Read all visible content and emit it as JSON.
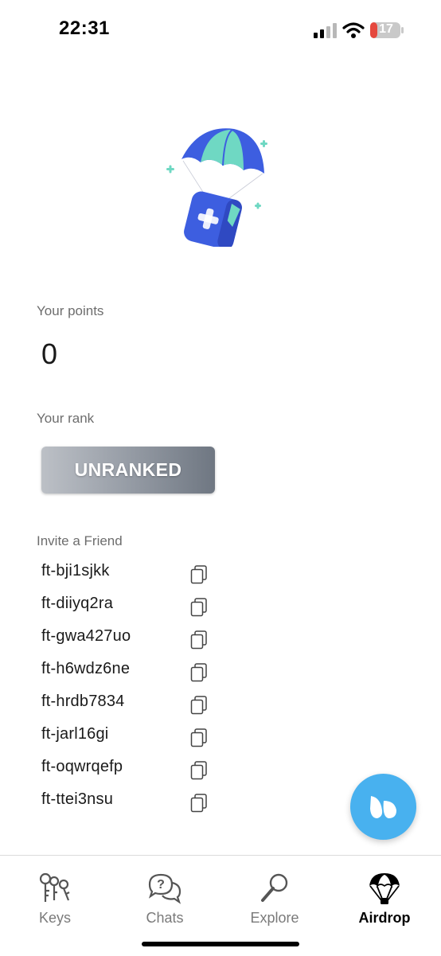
{
  "status_bar": {
    "time": "22:31",
    "battery": "17"
  },
  "points": {
    "label": "Your points",
    "value": "0"
  },
  "rank": {
    "label": "Your rank",
    "value": "UNRANKED"
  },
  "invite": {
    "label": "Invite a Friend",
    "codes": [
      "ft-bji1sjkk",
      "ft-diiyq2ra",
      "ft-gwa427uo",
      "ft-h6wdz6ne",
      "ft-hrdb7834",
      "ft-jarl16gi",
      "ft-oqwrqefp",
      "ft-ttei3nsu"
    ]
  },
  "tabs": [
    {
      "label": "Keys",
      "icon": "keys-icon"
    },
    {
      "label": "Chats",
      "icon": "chats-icon"
    },
    {
      "label": "Explore",
      "icon": "explore-icon"
    },
    {
      "label": "Airdrop",
      "icon": "airdrop-icon",
      "active": true
    }
  ],
  "colors": {
    "accent": "#48b1ef",
    "parachute_teal": "#6fd8c3",
    "parachute_blue": "#3d5ee0"
  }
}
